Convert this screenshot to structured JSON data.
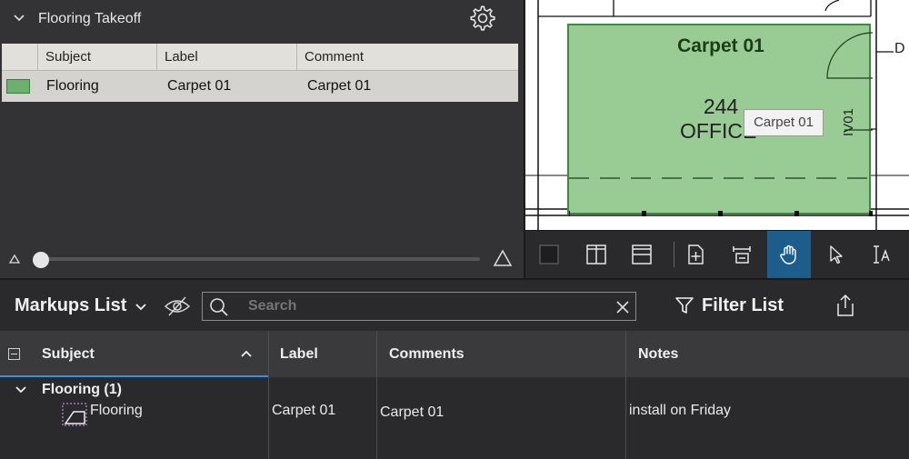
{
  "takeoff": {
    "title": "Flooring Takeoff",
    "columns": [
      "Subject",
      "Label",
      "Comment"
    ],
    "rows": [
      {
        "subject": "Flooring",
        "label": "Carpet 01",
        "comment": "Carpet 01",
        "swatch_color": "#6cb06e"
      }
    ],
    "opacity_slider_value": 0
  },
  "drawing": {
    "room_label": "Carpet 01",
    "room_number": "244",
    "room_name": "OFFICE",
    "tooltip": "Carpet 01",
    "wall_tag": "IV01",
    "door_tag": "D",
    "fill_color": "#99cc94",
    "border_color": "#3b8c3b"
  },
  "canvas_toolbar": {
    "tools": [
      "single-page-icon",
      "split-vertical-icon",
      "split-horizontal-icon",
      "page-add-icon",
      "dimension-icon",
      "pan-hand-icon",
      "select-arrow-icon",
      "text-select-icon"
    ],
    "active_tool": "pan-hand-icon"
  },
  "markups": {
    "title": "Markups List",
    "search_placeholder": "Search",
    "filter_label": "Filter List",
    "columns": {
      "subject": "Subject",
      "label": "Label",
      "comments": "Comments",
      "notes": "Notes"
    },
    "group": "Flooring (1)",
    "rows": [
      {
        "subject": "Flooring",
        "label": "Carpet 01",
        "comments": "Carpet 01",
        "notes": "install on Friday"
      }
    ]
  },
  "colors": {
    "accent": "#1d5d8c",
    "sort_underline": "#3c8ee0"
  }
}
